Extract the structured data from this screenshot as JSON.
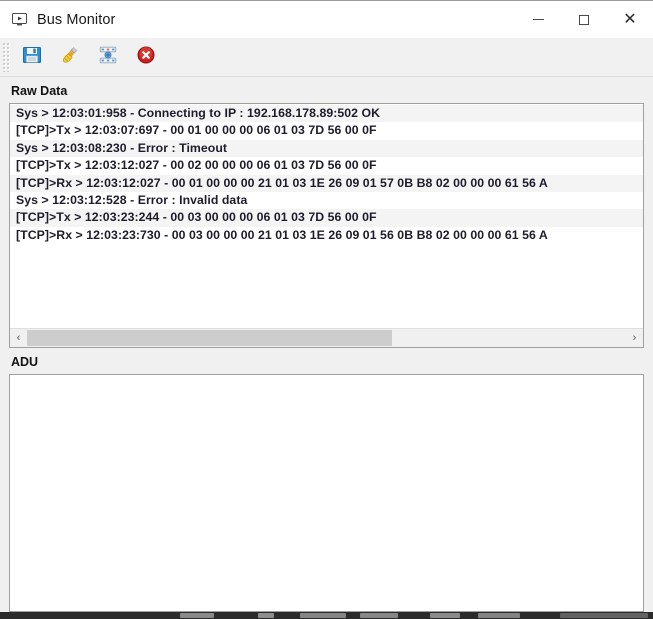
{
  "window": {
    "title": "Bus Monitor",
    "app_icon": "monitor-play-icon",
    "controls": {
      "minimize": "—",
      "maximize": "□",
      "close": "✕"
    }
  },
  "toolbar": {
    "buttons": [
      {
        "name": "save-button",
        "icon": "floppy-disk-save-icon",
        "label": "Save"
      },
      {
        "name": "clear-button",
        "icon": "broom-clear-icon",
        "label": "Clear"
      },
      {
        "name": "connection-button",
        "icon": "network-connection-icon",
        "label": "Connection"
      },
      {
        "name": "disconnect-button",
        "icon": "red-circle-close-icon",
        "label": "Disconnect"
      }
    ]
  },
  "sections": {
    "raw_data": {
      "label": "Raw Data",
      "rows": [
        "Sys > 12:03:01:958 - Connecting to IP : 192.168.178.89:502 OK",
        "[TCP]>Tx > 12:03:07:697 - 00  01  00  00  00  06  01  03  7D  56  00  0F",
        "Sys > 12:03:08:230 - Error : Timeout",
        "[TCP]>Tx > 12:03:12:027 - 00  02  00  00  00  06  01  03  7D  56  00  0F",
        "[TCP]>Rx > 12:03:12:027 - 00  01  00  00  00  21  01  03  1E  26  09  01  57  0B  B8  02  00  00  00  61  56  A",
        "Sys > 12:03:12:528 - Error : Invalid data",
        "[TCP]>Tx > 12:03:23:244 - 00  03  00  00  00  06  01  03  7D  56  00  0F",
        "[TCP]>Rx > 12:03:23:730 - 00  03  00  00  00  21  01  03  1E  26  09  01  56  0B  B8  02  00  00  00  61  56  A"
      ],
      "scrollbar": {
        "left_arrow": "‹",
        "right_arrow": "›",
        "thumb_percent": 61
      }
    },
    "adu": {
      "label": "ADU",
      "rows": []
    }
  },
  "colors": {
    "title_bar": "#ffffff",
    "toolbar": "#f1f1f1",
    "window_bg": "#f0f0f0",
    "list_bg": "#ffffff",
    "row_alt": "#f4f4f4",
    "text": "#1d1d2b",
    "border": "#a0a0a0",
    "scroll_thumb": "#cdcdcd"
  }
}
